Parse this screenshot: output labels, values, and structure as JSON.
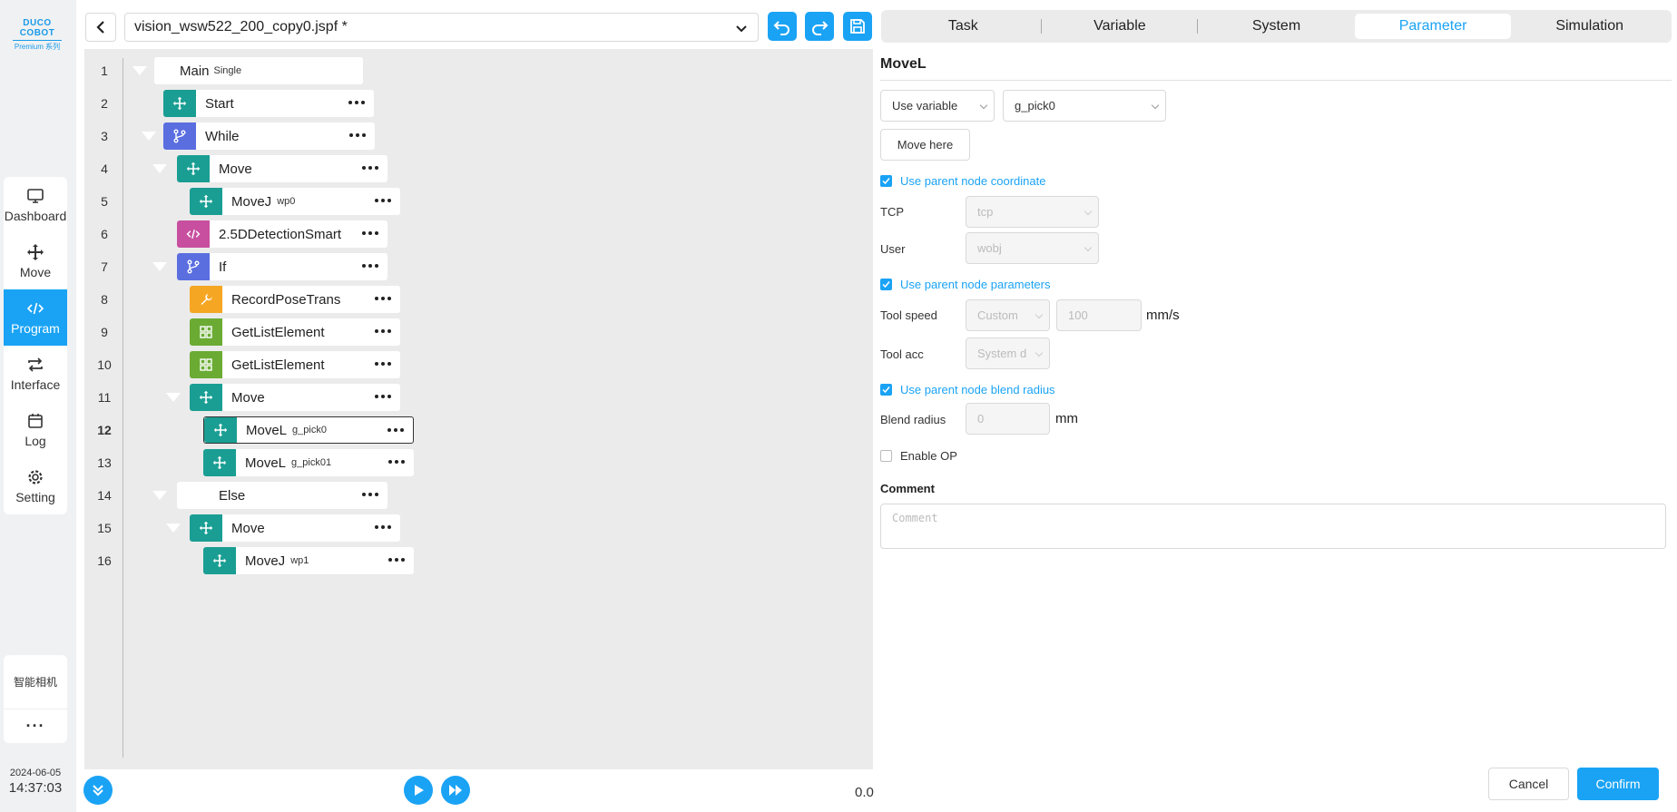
{
  "brand": {
    "name": "DUCO COBOT",
    "sub": "Premium 系列"
  },
  "nav": {
    "items": [
      {
        "label": "Dashboard",
        "icon": "monitor-icon"
      },
      {
        "label": "Move",
        "icon": "move-arrows-icon"
      },
      {
        "label": "Program",
        "icon": "code-icon",
        "active": true
      },
      {
        "label": "Interface",
        "icon": "swap-arrows-icon"
      },
      {
        "label": "Log",
        "icon": "calendar-icon"
      },
      {
        "label": "Setting",
        "icon": "gear-icon"
      }
    ],
    "camera_label": "智能相机",
    "more_label": "···"
  },
  "clock": {
    "date": "2024-06-05",
    "time": "14:37:03"
  },
  "program": {
    "file_name": "vision_wsw522_200_copy0.jspf *"
  },
  "tree": [
    {
      "num": "1",
      "label": "Main",
      "tag": "Single"
    },
    {
      "num": "2",
      "label": "Start",
      "tag": ""
    },
    {
      "num": "3",
      "label": "While",
      "tag": ""
    },
    {
      "num": "4",
      "label": "Move",
      "tag": ""
    },
    {
      "num": "5",
      "label": "MoveJ",
      "tag": "wp0"
    },
    {
      "num": "6",
      "label": "2.5DDetectionSmart",
      "tag": ""
    },
    {
      "num": "7",
      "label": "If",
      "tag": ""
    },
    {
      "num": "8",
      "label": "RecordPoseTrans",
      "tag": ""
    },
    {
      "num": "9",
      "label": "GetListElement",
      "tag": ""
    },
    {
      "num": "10",
      "label": "GetListElement",
      "tag": ""
    },
    {
      "num": "11",
      "label": "Move",
      "tag": ""
    },
    {
      "num": "12",
      "label": "MoveL",
      "tag": "g_pick0"
    },
    {
      "num": "13",
      "label": "MoveL",
      "tag": "g_pick01"
    },
    {
      "num": "14",
      "label": "Else",
      "tag": ""
    },
    {
      "num": "15",
      "label": "Move",
      "tag": ""
    },
    {
      "num": "16",
      "label": "MoveJ",
      "tag": "wp1"
    }
  ],
  "speed_value": "0.0",
  "tabs": [
    "Task",
    "Variable",
    "System",
    "Parameter",
    "Simulation"
  ],
  "active_tab": "Parameter",
  "param": {
    "title": "MoveL",
    "point_source": "Use variable",
    "point_variable": "g_pick0",
    "move_here": "Move here",
    "use_parent_coord": "Use parent node coordinate",
    "tcp_label": "TCP",
    "tcp_value": "tcp",
    "user_label": "User",
    "user_value": "wobj",
    "use_parent_params": "Use parent node parameters",
    "tool_speed_label": "Tool speed",
    "tool_speed_mode": "Custom",
    "tool_speed_value": "100",
    "tool_speed_unit": "mm/s",
    "tool_acc_label": "Tool acc",
    "tool_acc_mode": "System d",
    "use_parent_blend": "Use parent node blend radius",
    "blend_label": "Blend radius",
    "blend_value": "0",
    "blend_unit": "mm",
    "enable_op": "Enable OP",
    "comment_label": "Comment",
    "comment_placeholder": "Comment"
  },
  "buttons": {
    "cancel": "Cancel",
    "confirm": "Confirm"
  },
  "colors": {
    "accent": "#1aa3f5",
    "move_node": "#1a9e93",
    "flow_node": "#5a6ee0",
    "script_node": "#c84fa0",
    "tool_node": "#f5a623",
    "list_node": "#6bab34"
  }
}
